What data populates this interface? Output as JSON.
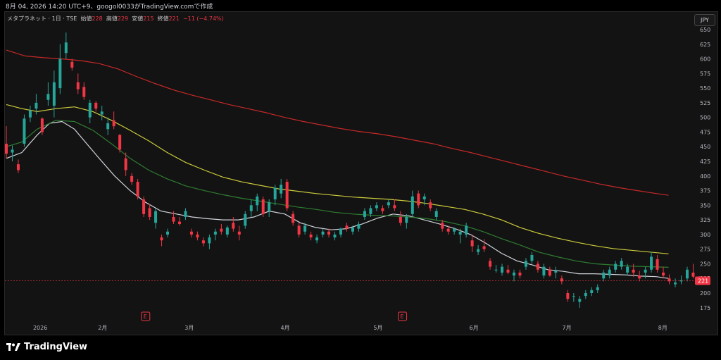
{
  "header": {
    "caption": "8月 04, 2026 14:20 UTC+9、googol0033がTradingView.comで作成"
  },
  "legend": {
    "symbol": "メタプラネット · 1日 · TSE",
    "open_label": "始値",
    "open": "228",
    "high_label": "高値",
    "high": "229",
    "low_label": "安値",
    "low": "215",
    "close_label": "終値",
    "close": "221",
    "change": "−11 (−4.74%)"
  },
  "currency_button": "JPY",
  "brand": {
    "name": "TradingView"
  },
  "icons": {
    "logo": "tradingview-logo-icon",
    "earnings": "earnings-e-icon"
  },
  "colors": {
    "up": "#26a69a",
    "down": "#f23645",
    "ma_short": "#d1d4dc",
    "ma_mid": "#2e7d32",
    "ma_long": "#cdcb3b",
    "ma_longest": "#c62828",
    "price_line": "#f23645"
  },
  "chart_data": {
    "type": "candlestick",
    "ylim": [
      170,
      660
    ],
    "y_ticks": [
      650,
      625,
      600,
      575,
      550,
      525,
      500,
      475,
      450,
      425,
      400,
      375,
      350,
      325,
      300,
      275,
      250,
      225,
      200,
      175
    ],
    "x_ticks": [
      {
        "label": "2026",
        "day": 10
      },
      {
        "label": "2月",
        "day": 31
      },
      {
        "label": "3月",
        "day": 59
      },
      {
        "label": "4月",
        "day": 90
      },
      {
        "label": "5月",
        "day": 120
      },
      {
        "label": "6月",
        "day": 151
      },
      {
        "label": "7月",
        "day": 181
      },
      {
        "label": "8月",
        "day": 212
      }
    ],
    "earnings_markers": [
      {
        "label": "E",
        "day": 45
      },
      {
        "label": "E",
        "day": 128
      }
    ],
    "last_price": 221,
    "candles": [
      [
        455,
        485,
        430,
        438
      ],
      [
        440,
        452,
        425,
        445
      ],
      [
        420,
        428,
        405,
        410
      ],
      [
        455,
        505,
        450,
        498
      ],
      [
        500,
        520,
        492,
        512
      ],
      [
        515,
        540,
        505,
        525
      ],
      [
        498,
        500,
        470,
        475
      ],
      [
        530,
        560,
        520,
        540
      ],
      [
        520,
        580,
        500,
        560
      ],
      [
        550,
        625,
        540,
        600
      ],
      [
        610,
        645,
        600,
        628
      ],
      [
        595,
        600,
        580,
        585
      ],
      [
        560,
        575,
        540,
        548
      ],
      [
        552,
        560,
        530,
        535
      ],
      [
        500,
        530,
        490,
        525
      ],
      [
        525,
        528,
        510,
        515
      ],
      [
        505,
        520,
        495,
        510
      ],
      [
        480,
        500,
        470,
        490
      ],
      [
        495,
        510,
        480,
        485
      ],
      [
        470,
        472,
        440,
        445
      ],
      [
        430,
        440,
        400,
        410
      ],
      [
        400,
        405,
        385,
        390
      ],
      [
        390,
        395,
        360,
        365
      ],
      [
        360,
        365,
        330,
        335
      ],
      [
        345,
        352,
        325,
        330
      ],
      [
        320,
        345,
        310,
        340
      ],
      [
        295,
        300,
        280,
        290
      ],
      [
        300,
        310,
        295,
        305
      ],
      [
        330,
        340,
        318,
        322
      ],
      [
        322,
        330,
        315,
        318
      ],
      [
        330,
        345,
        325,
        340
      ],
      [
        305,
        310,
        295,
        300
      ],
      [
        300,
        305,
        290,
        295
      ],
      [
        290,
        295,
        280,
        285
      ],
      [
        285,
        300,
        275,
        295
      ],
      [
        300,
        310,
        290,
        305
      ],
      [
        310,
        318,
        300,
        305
      ],
      [
        300,
        315,
        295,
        312
      ],
      [
        320,
        330,
        305,
        310
      ],
      [
        305,
        315,
        290,
        300
      ],
      [
        315,
        340,
        310,
        335
      ],
      [
        340,
        360,
        330,
        350
      ],
      [
        350,
        370,
        340,
        365
      ],
      [
        360,
        365,
        330,
        335
      ],
      [
        340,
        360,
        330,
        355
      ],
      [
        360,
        385,
        350,
        380
      ],
      [
        370,
        395,
        362,
        385
      ],
      [
        390,
        395,
        340,
        345
      ],
      [
        335,
        340,
        315,
        320
      ],
      [
        315,
        320,
        295,
        300
      ],
      [
        305,
        320,
        300,
        315
      ],
      [
        300,
        305,
        290,
        295
      ],
      [
        290,
        300,
        285,
        295
      ],
      [
        300,
        310,
        295,
        305
      ],
      [
        305,
        310,
        295,
        300
      ],
      [
        295,
        305,
        290,
        300
      ],
      [
        300,
        312,
        295,
        310
      ],
      [
        315,
        320,
        305,
        310
      ],
      [
        305,
        315,
        300,
        312
      ],
      [
        310,
        322,
        305,
        318
      ],
      [
        330,
        345,
        325,
        340
      ],
      [
        335,
        350,
        330,
        345
      ],
      [
        345,
        355,
        340,
        350
      ],
      [
        345,
        350,
        335,
        340
      ],
      [
        350,
        360,
        345,
        355
      ],
      [
        350,
        360,
        340,
        345
      ],
      [
        330,
        340,
        315,
        320
      ],
      [
        320,
        335,
        310,
        330
      ],
      [
        335,
        375,
        330,
        365
      ],
      [
        370,
        375,
        345,
        350
      ],
      [
        360,
        370,
        350,
        365
      ],
      [
        355,
        360,
        340,
        345
      ],
      [
        330,
        345,
        325,
        340
      ],
      [
        320,
        325,
        305,
        310
      ],
      [
        310,
        315,
        300,
        305
      ],
      [
        305,
        312,
        300,
        310
      ],
      [
        300,
        310,
        285,
        305
      ],
      [
        300,
        320,
        295,
        315
      ],
      [
        290,
        300,
        270,
        280
      ],
      [
        270,
        282,
        265,
        275
      ],
      [
        280,
        292,
        270,
        275
      ],
      [
        255,
        260,
        240,
        245
      ],
      [
        240,
        248,
        235,
        240
      ],
      [
        235,
        250,
        230,
        245
      ],
      [
        240,
        248,
        232,
        235
      ],
      [
        230,
        240,
        220,
        235
      ],
      [
        235,
        240,
        225,
        230
      ],
      [
        245,
        260,
        240,
        255
      ],
      [
        255,
        270,
        250,
        265
      ],
      [
        250,
        255,
        235,
        240
      ],
      [
        230,
        250,
        225,
        245
      ],
      [
        240,
        245,
        228,
        230
      ],
      [
        235,
        245,
        225,
        238
      ],
      [
        225,
        230,
        215,
        220
      ],
      [
        200,
        205,
        185,
        190
      ],
      [
        195,
        200,
        185,
        195
      ],
      [
        185,
        195,
        175,
        190
      ],
      [
        195,
        205,
        190,
        200
      ],
      [
        200,
        210,
        195,
        205
      ],
      [
        205,
        215,
        200,
        210
      ],
      [
        225,
        240,
        220,
        235
      ],
      [
        230,
        245,
        225,
        240
      ],
      [
        240,
        255,
        235,
        250
      ],
      [
        245,
        260,
        240,
        255
      ],
      [
        235,
        250,
        230,
        245
      ],
      [
        240,
        250,
        228,
        235
      ],
      [
        230,
        238,
        220,
        225
      ],
      [
        235,
        245,
        225,
        240
      ],
      [
        240,
        270,
        235,
        262
      ],
      [
        258,
        265,
        235,
        240
      ],
      [
        235,
        245,
        225,
        230
      ],
      [
        225,
        232,
        215,
        220
      ],
      [
        215,
        225,
        210,
        218
      ],
      [
        220,
        230,
        215,
        222
      ],
      [
        225,
        245,
        220,
        240
      ],
      [
        235,
        250,
        225,
        228
      ],
      [
        228,
        229,
        215,
        221
      ]
    ],
    "series": [
      {
        "color": "#d1d4dc",
        "points": [
          [
            0,
            430
          ],
          [
            5,
            440
          ],
          [
            10,
            470
          ],
          [
            14,
            490
          ],
          [
            18,
            493
          ],
          [
            22,
            480
          ],
          [
            26,
            455
          ],
          [
            30,
            430
          ],
          [
            35,
            400
          ],
          [
            40,
            375
          ],
          [
            45,
            355
          ],
          [
            50,
            340
          ],
          [
            55,
            335
          ],
          [
            60,
            330
          ],
          [
            65,
            327
          ],
          [
            70,
            325
          ],
          [
            75,
            325
          ],
          [
            80,
            330
          ],
          [
            85,
            340
          ],
          [
            90,
            335
          ],
          [
            95,
            320
          ],
          [
            100,
            312
          ],
          [
            105,
            308
          ],
          [
            110,
            310
          ],
          [
            115,
            318
          ],
          [
            120,
            328
          ],
          [
            125,
            335
          ],
          [
            130,
            332
          ],
          [
            135,
            325
          ],
          [
            140,
            318
          ],
          [
            145,
            310
          ],
          [
            150,
            300
          ],
          [
            155,
            285
          ],
          [
            160,
            268
          ],
          [
            165,
            255
          ],
          [
            170,
            248
          ],
          [
            175,
            240
          ],
          [
            180,
            237
          ],
          [
            185,
            233
          ],
          [
            190,
            233
          ],
          [
            195,
            232
          ],
          [
            200,
            231
          ],
          [
            205,
            229
          ],
          [
            210,
            228
          ],
          [
            214,
            225
          ]
        ]
      },
      {
        "color": "#2e7d32",
        "points": [
          [
            0,
            450
          ],
          [
            5,
            458
          ],
          [
            10,
            480
          ],
          [
            16,
            495
          ],
          [
            22,
            493
          ],
          [
            28,
            478
          ],
          [
            34,
            455
          ],
          [
            40,
            430
          ],
          [
            46,
            410
          ],
          [
            52,
            395
          ],
          [
            58,
            383
          ],
          [
            64,
            375
          ],
          [
            70,
            368
          ],
          [
            76,
            362
          ],
          [
            82,
            357
          ],
          [
            88,
            352
          ],
          [
            94,
            347
          ],
          [
            100,
            343
          ],
          [
            106,
            338
          ],
          [
            112,
            335
          ],
          [
            118,
            333
          ],
          [
            124,
            332
          ],
          [
            130,
            330
          ],
          [
            136,
            327
          ],
          [
            142,
            322
          ],
          [
            148,
            315
          ],
          [
            154,
            305
          ],
          [
            160,
            293
          ],
          [
            166,
            282
          ],
          [
            172,
            270
          ],
          [
            178,
            262
          ],
          [
            184,
            255
          ],
          [
            190,
            250
          ],
          [
            196,
            248
          ],
          [
            202,
            246
          ],
          [
            208,
            245
          ],
          [
            214,
            244
          ]
        ]
      },
      {
        "color": "#cdcb3b",
        "points": [
          [
            0,
            522
          ],
          [
            5,
            515
          ],
          [
            10,
            510
          ],
          [
            16,
            515
          ],
          [
            22,
            518
          ],
          [
            28,
            510
          ],
          [
            34,
            495
          ],
          [
            40,
            478
          ],
          [
            46,
            460
          ],
          [
            52,
            440
          ],
          [
            58,
            423
          ],
          [
            64,
            410
          ],
          [
            70,
            398
          ],
          [
            76,
            390
          ],
          [
            82,
            384
          ],
          [
            88,
            378
          ],
          [
            94,
            374
          ],
          [
            100,
            370
          ],
          [
            106,
            367
          ],
          [
            112,
            364
          ],
          [
            118,
            362
          ],
          [
            124,
            360
          ],
          [
            130,
            357
          ],
          [
            136,
            353
          ],
          [
            142,
            348
          ],
          [
            148,
            343
          ],
          [
            154,
            335
          ],
          [
            160,
            325
          ],
          [
            166,
            312
          ],
          [
            172,
            302
          ],
          [
            178,
            294
          ],
          [
            184,
            287
          ],
          [
            190,
            281
          ],
          [
            196,
            276
          ],
          [
            202,
            273
          ],
          [
            208,
            270
          ],
          [
            214,
            267
          ]
        ]
      },
      {
        "color": "#c62828",
        "points": [
          [
            0,
            615
          ],
          [
            6,
            605
          ],
          [
            12,
            602
          ],
          [
            18,
            600
          ],
          [
            24,
            597
          ],
          [
            30,
            592
          ],
          [
            36,
            583
          ],
          [
            42,
            570
          ],
          [
            48,
            558
          ],
          [
            54,
            547
          ],
          [
            60,
            538
          ],
          [
            66,
            530
          ],
          [
            72,
            522
          ],
          [
            78,
            515
          ],
          [
            84,
            508
          ],
          [
            90,
            500
          ],
          [
            96,
            493
          ],
          [
            102,
            487
          ],
          [
            108,
            481
          ],
          [
            114,
            476
          ],
          [
            120,
            472
          ],
          [
            126,
            467
          ],
          [
            132,
            461
          ],
          [
            138,
            455
          ],
          [
            144,
            447
          ],
          [
            150,
            440
          ],
          [
            156,
            432
          ],
          [
            162,
            424
          ],
          [
            168,
            416
          ],
          [
            174,
            408
          ],
          [
            180,
            400
          ],
          [
            186,
            393
          ],
          [
            192,
            386
          ],
          [
            198,
            380
          ],
          [
            204,
            375
          ],
          [
            210,
            370
          ],
          [
            214,
            367
          ]
        ]
      }
    ]
  }
}
